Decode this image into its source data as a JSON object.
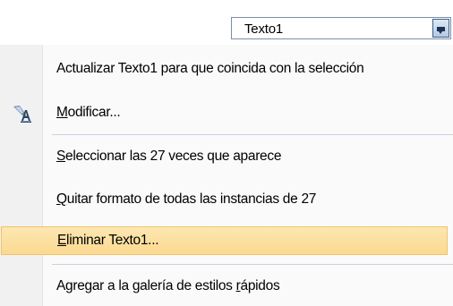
{
  "combo": {
    "value": "Texto1"
  },
  "menu": {
    "items": [
      {
        "label": "Actualizar Texto1 para que coincida con la selección"
      },
      {
        "pre": "",
        "accel": "M",
        "post": "odificar..."
      },
      {
        "pre": "",
        "accel": "S",
        "post": "eleccionar las 27 veces que aparece"
      },
      {
        "pre": "",
        "accel": "Q",
        "post": "uitar formato de todas las instancias de 27"
      },
      {
        "pre": "",
        "accel": "E",
        "post": "liminar Texto1..."
      },
      {
        "pre": "Agregar a la galería de estilos ",
        "accel": "r",
        "post": "ápidos"
      }
    ],
    "hover_index": 4
  },
  "icons": {
    "modify": "paint-brush-a-icon",
    "dropdown": "dropdown-arrow-icon"
  },
  "colors": {
    "hover_fill": "#fbd990",
    "hover_border": "#f2c26a",
    "separator": "#c8d2e0",
    "gutter": "#f1f1f1"
  }
}
